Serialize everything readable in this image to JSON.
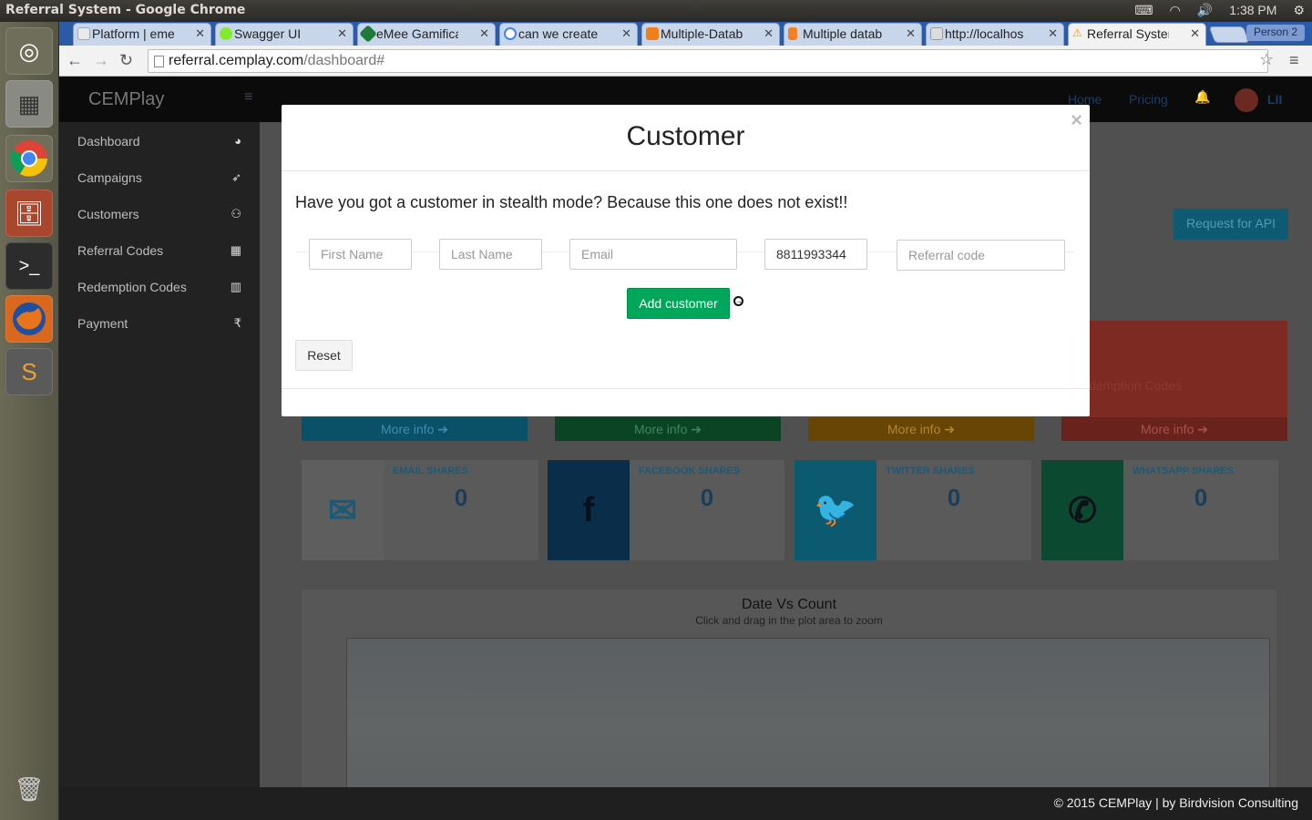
{
  "os": {
    "window_title": "Referral System - Google Chrome",
    "clock": "1:38 PM",
    "launcher_apps": [
      "ubuntu-icon",
      "calculator-icon",
      "chrome-icon",
      "file-manager-icon",
      "terminal-icon",
      "firefox-icon",
      "sublime-text-icon",
      "trash-icon"
    ]
  },
  "browser": {
    "tabs": [
      {
        "label": "Platform | eme",
        "favicon": "emee-icon"
      },
      {
        "label": "Swagger UI",
        "favicon": "swagger-icon"
      },
      {
        "label": "eMee Gamifica",
        "favicon": "emee-gem-icon"
      },
      {
        "label": "can we create t",
        "favicon": "google-icon"
      },
      {
        "label": "Multiple-Datab",
        "favicon": "blog-icon"
      },
      {
        "label": "Multiple datab",
        "favicon": "stackoverflow-icon"
      },
      {
        "label": "http://localhos",
        "favicon": "page-icon"
      },
      {
        "label": "Referral Systen",
        "favicon": "warning-icon"
      }
    ],
    "profile": "Person 2",
    "url_host": "referral.cemplay.com",
    "url_path": "/dashboard#"
  },
  "app": {
    "brand": "CEMPlay",
    "nav": {
      "home": "Home",
      "pricing": "Pricing",
      "user": "LII"
    },
    "sidebar": [
      {
        "label": "Dashboard",
        "icon": "dashboard-icon",
        "glyph": "◕"
      },
      {
        "label": "Campaigns",
        "icon": "rocket-icon",
        "glyph": "➶"
      },
      {
        "label": "Customers",
        "icon": "users-icon",
        "glyph": "⚇"
      },
      {
        "label": "Referral Codes",
        "icon": "qrcode-icon",
        "glyph": "▦"
      },
      {
        "label": "Redemption Codes",
        "icon": "barcode-icon",
        "glyph": "▥"
      },
      {
        "label": "Payment",
        "icon": "rupee-icon",
        "glyph": "₹"
      }
    ],
    "request_api": "Request for API",
    "boxes": [
      {
        "more": "More info ➔",
        "bg": "#0c5f78",
        "fg": "#3d8fb0"
      },
      {
        "more": "More info ➔",
        "bg": "#0d4f2c",
        "fg": "#3e8a5a"
      },
      {
        "more": "More info ➔",
        "bg": "#7a5206",
        "fg": "#b3872f"
      },
      {
        "more": "More info ➔",
        "label": "demption Codes",
        "bg": "#7c2a22",
        "fg": "#a85349"
      }
    ],
    "shares": [
      {
        "label": "EMAIL SHARES",
        "value": "0",
        "icon": "envelope-icon",
        "glyph": "✉",
        "bg": "#5e5e5e",
        "fg": "#1a5a78"
      },
      {
        "label": "FACEBOOK SHARES",
        "value": "0",
        "icon": "facebook-icon",
        "glyph": "f",
        "bg": "#0a2d4a",
        "fg": "#0b0f16"
      },
      {
        "label": "TWITTER SHARES",
        "value": "0",
        "icon": "twitter-icon",
        "glyph": "🐦",
        "bg": "#0b5a70",
        "fg": "#0b0f16"
      },
      {
        "label": "WHATSAPP SHARES",
        "value": "0",
        "icon": "whatsapp-icon",
        "glyph": "✆",
        "bg": "#0b4a30",
        "fg": "#0b0f16"
      }
    ],
    "chart": {
      "title": "Date Vs Count",
      "subtitle": "Click and drag in the plot area to zoom"
    },
    "footer": "© 2015 CEMPlay | by Birdvision Consulting"
  },
  "modal": {
    "title": "Customer",
    "close": "×",
    "message": "Have you got a customer in stealth mode? Because this one does not exist!!",
    "fields": {
      "first_name": {
        "placeholder": "First Name",
        "value": ""
      },
      "last_name": {
        "placeholder": "Last Name",
        "value": ""
      },
      "email": {
        "placeholder": "Email",
        "value": ""
      },
      "phone": {
        "placeholder": "",
        "value": "8811993344"
      },
      "referral_code": {
        "placeholder": "Referral code",
        "value": ""
      }
    },
    "add_button": "Add customer",
    "reset_button": "Reset"
  }
}
